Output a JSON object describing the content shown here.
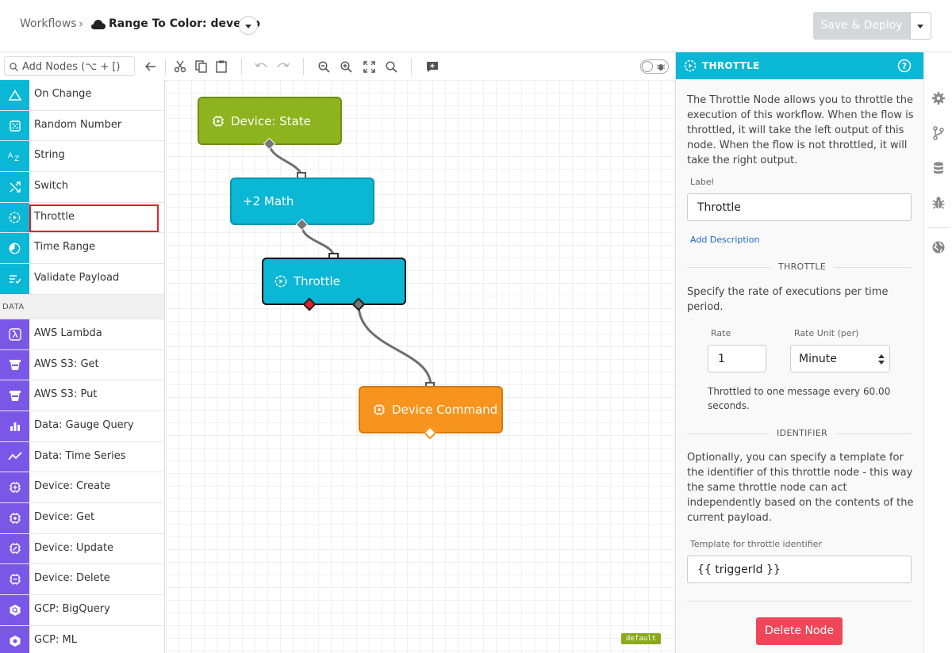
{
  "header": {
    "breadcrumb": "Workflows",
    "separator": "›",
    "workflow_title": "Range To Color: develop",
    "deploy_label": "Save & Deploy"
  },
  "toolbar": {
    "search_placeholder": "Add Nodes (⌥ + [)"
  },
  "palette": {
    "logic_items": [
      {
        "label": "On Change",
        "icon": "triangle-icon"
      },
      {
        "label": "Random Number",
        "icon": "dice-icon"
      },
      {
        "label": "String",
        "icon": "az-icon"
      },
      {
        "label": "Switch",
        "icon": "shuffle-icon"
      },
      {
        "label": "Throttle",
        "icon": "throttle-icon"
      },
      {
        "label": "Time Range",
        "icon": "clock-icon"
      },
      {
        "label": "Validate Payload",
        "icon": "list-check-icon"
      }
    ],
    "data_section": "DATA",
    "data_items": [
      {
        "label": "AWS Lambda",
        "icon": "lambda-icon"
      },
      {
        "label": "AWS S3: Get",
        "icon": "bucket-icon"
      },
      {
        "label": "AWS S3: Put",
        "icon": "bucket-icon"
      },
      {
        "label": "Data: Gauge Query",
        "icon": "bar-chart-icon"
      },
      {
        "label": "Data: Time Series",
        "icon": "line-chart-icon"
      },
      {
        "label": "Device: Create",
        "icon": "chip-icon"
      },
      {
        "label": "Device: Get",
        "icon": "chip-icon"
      },
      {
        "label": "Device: Update",
        "icon": "chip-icon"
      },
      {
        "label": "Device: Delete",
        "icon": "chip-icon"
      },
      {
        "label": "GCP: BigQuery",
        "icon": "hexagon-icon"
      },
      {
        "label": "GCP: ML",
        "icon": "hexagon-icon"
      }
    ]
  },
  "canvas": {
    "nodes": {
      "device_state": "Device: State",
      "math": "+2  Math",
      "throttle": "Throttle",
      "device_command": "Device Command"
    },
    "default_badge": "default"
  },
  "panel": {
    "title": "THROTTLE",
    "description": "The Throttle Node allows you to throttle the execution of this workflow. When the flow is throttled, it will take the left output of this node. When the flow is not throttled, it will take the right output.",
    "label_caption": "Label",
    "label_value": "Throttle",
    "add_description": "Add Description",
    "throttle_section": "THROTTLE",
    "rate_text": "Specify the rate of executions per time period.",
    "rate_caption": "Rate",
    "rate_value": "1",
    "rate_unit_caption": "Rate Unit (per)",
    "rate_unit_value": "Minute",
    "throttled_text": "Throttled to one message every 60.00 seconds.",
    "identifier_section": "IDENTIFIER",
    "identifier_text": "Optionally, you can specify a template for the identifier of this throttle node - this way the same throttle node can act independently based on the contents of the current payload.",
    "template_caption": "Template for throttle identifier",
    "template_value": "{{ triggerId }}",
    "delete_label": "Delete Node"
  },
  "colors": {
    "logic": "#0ab7d4",
    "data": "#7a57e6",
    "trigger_node": "#8db31e",
    "output_node": "#f7941d",
    "delete": "#f0465a"
  }
}
